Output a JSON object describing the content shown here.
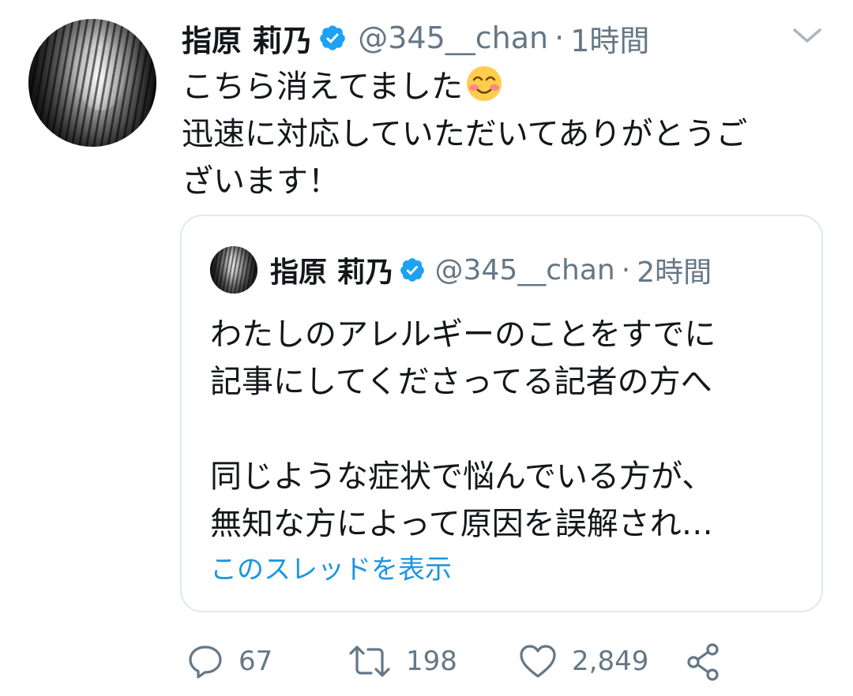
{
  "tweet": {
    "author": {
      "name": "指原 莉乃",
      "handle": "@345__chan",
      "time": "1時間",
      "separator": "·",
      "verified": true
    },
    "text_lines": [
      "こちら消えてました",
      "迅速に対応していただいてありがとうご",
      "ざいます！"
    ],
    "emoji": "smiling-face-with-smiling-eyes-and-blush-emoji"
  },
  "quoted_tweet": {
    "author": {
      "name": "指原 莉乃",
      "handle": "@345__chan",
      "time": "2時間",
      "separator": "·",
      "verified": true
    },
    "text_lines": [
      "わたしのアレルギーのことをすでに",
      "記事にしてくださってる記者の方へ",
      "",
      "同じような症状で悩んでいる方が、",
      "無知な方によって原因を誤解され…"
    ],
    "thread_link": "このスレッドを表示"
  },
  "actions": {
    "reply_count": "67",
    "retweet_count": "198",
    "like_count": "2,849"
  },
  "colors": {
    "text_primary": "#14171a",
    "text_secondary": "#657786",
    "link": "#1b95e0",
    "verified_badge": "#1da1f2",
    "border": "#e1e8ed"
  },
  "icons": [
    "verified-badge-icon",
    "caret-down-icon",
    "reply-icon",
    "retweet-icon",
    "like-icon",
    "share-icon"
  ]
}
